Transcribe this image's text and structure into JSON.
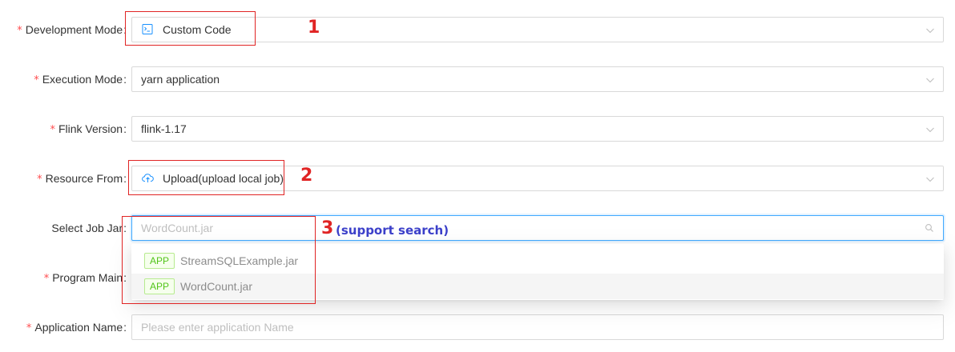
{
  "form": {
    "development_mode": {
      "label": "Development Mode",
      "value": "Custom Code",
      "required": true,
      "icon": "terminal-icon"
    },
    "execution_mode": {
      "label": "Execution Mode",
      "value": "yarn application",
      "required": true
    },
    "flink_version": {
      "label": "Flink Version",
      "value": "flink-1.17",
      "required": true
    },
    "resource_from": {
      "label": "Resource From",
      "value": "Upload(upload local job)",
      "required": true,
      "icon": "cloud-upload-icon"
    },
    "select_job_jar": {
      "label": "Select Job Jar",
      "placeholder": "WordCount.jar",
      "required": false,
      "options": [
        {
          "tag": "APP",
          "label": "StreamSQLExample.jar"
        },
        {
          "tag": "APP",
          "label": "WordCount.jar",
          "active": true
        }
      ]
    },
    "program_main": {
      "label": "Program Main",
      "required": true
    },
    "application_name": {
      "label": "Application Name",
      "placeholder": "Please enter application Name",
      "required": true
    }
  },
  "annotations": {
    "n1": "1",
    "n2": "2",
    "n3": "3",
    "note3": "(support search)"
  },
  "colors": {
    "annotation_red": "#e02424",
    "annotation_blue": "#3b3fc9",
    "tag_green": "#52c41a",
    "focus_blue": "#40a9ff",
    "required_star": "#ff4d4f"
  }
}
